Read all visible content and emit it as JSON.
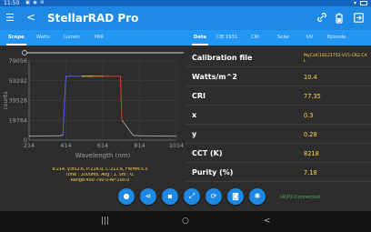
{
  "status_bar": {
    "time": "11:50",
    "icons": "▣ ◉ ✉"
  },
  "app_bar": {
    "title": "StellarRAD Pro",
    "menu_icon": "☰",
    "back_icon": "<"
  },
  "left_tabs": [
    "Scope",
    "Watts",
    "Lumen",
    "PAR"
  ],
  "right_tabs": [
    "Data",
    "CIE 1931",
    "CRI",
    "Solar",
    "UV",
    "Episode"
  ],
  "chart": {
    "y_ticks": [
      "79056",
      "59292",
      "39528",
      "19764",
      "0"
    ],
    "x_ticks": [
      "214",
      "414",
      "614",
      "814",
      "1014"
    ],
    "ylabel": "counts",
    "xlabel": "Wavelength (nm)",
    "colors": {
      "blue": "#5060e8",
      "green": "#4caf50",
      "red": "#e53935",
      "orange": "#ff9800",
      "yellow": "#ffd54f"
    }
  },
  "chart_data": {
    "type": "line",
    "xlabel": "Wavelength (nm)",
    "ylabel": "counts",
    "xlim": [
      214,
      1014
    ],
    "ylim": [
      0,
      79056
    ],
    "x_ticks": [
      214,
      414,
      614,
      814,
      1014
    ],
    "y_ticks": [
      0,
      19764,
      39528,
      59292,
      79056
    ],
    "series": [
      {
        "x": [
          214,
          380,
          398,
          405,
          414,
          450,
          500,
          560,
          620,
          660,
          700,
          710,
          718,
          780,
          814,
          860,
          920,
          1014
        ],
        "y": [
          4000,
          4300,
          5000,
          35000,
          63800,
          63800,
          63800,
          63800,
          63800,
          63800,
          63800,
          63800,
          20000,
          4600,
          4300,
          4200,
          4100,
          4000
        ]
      }
    ]
  },
  "readout": [
    "x:214, y:852.6, P:216.0, C:212.6, FWHM:5.5",
    "Time : 1000ms, Avg : 1, Sm : 0,",
    "Range:400-700 0-AP:100.0"
  ],
  "data_rows": [
    {
      "label": "Calibration file",
      "value": "MyCalC18121752-V15-CR2.CAL"
    },
    {
      "label": "Watts/m^2",
      "value": "10.4"
    },
    {
      "label": "CRI",
      "value": "77.35"
    },
    {
      "label": "x",
      "value": "0.3"
    },
    {
      "label": "y",
      "value": "0.28"
    },
    {
      "label": "CCT (K)",
      "value": "8218"
    },
    {
      "label": "Purity (%)",
      "value": "7.18"
    }
  ],
  "actions": {
    "icons": [
      "lightbulb-icon",
      "share-icon",
      "save-icon",
      "expand-icon",
      "refresh-icon",
      "camera-icon",
      "settings-icon"
    ],
    "glyphs": [
      "●",
      "⋖",
      "▪",
      "⤢",
      "⟳",
      "◙",
      "✱"
    ]
  },
  "connection_status": "(A)P2-Connected",
  "nav": {
    "recents": "|||",
    "home": "○",
    "back": "<"
  }
}
